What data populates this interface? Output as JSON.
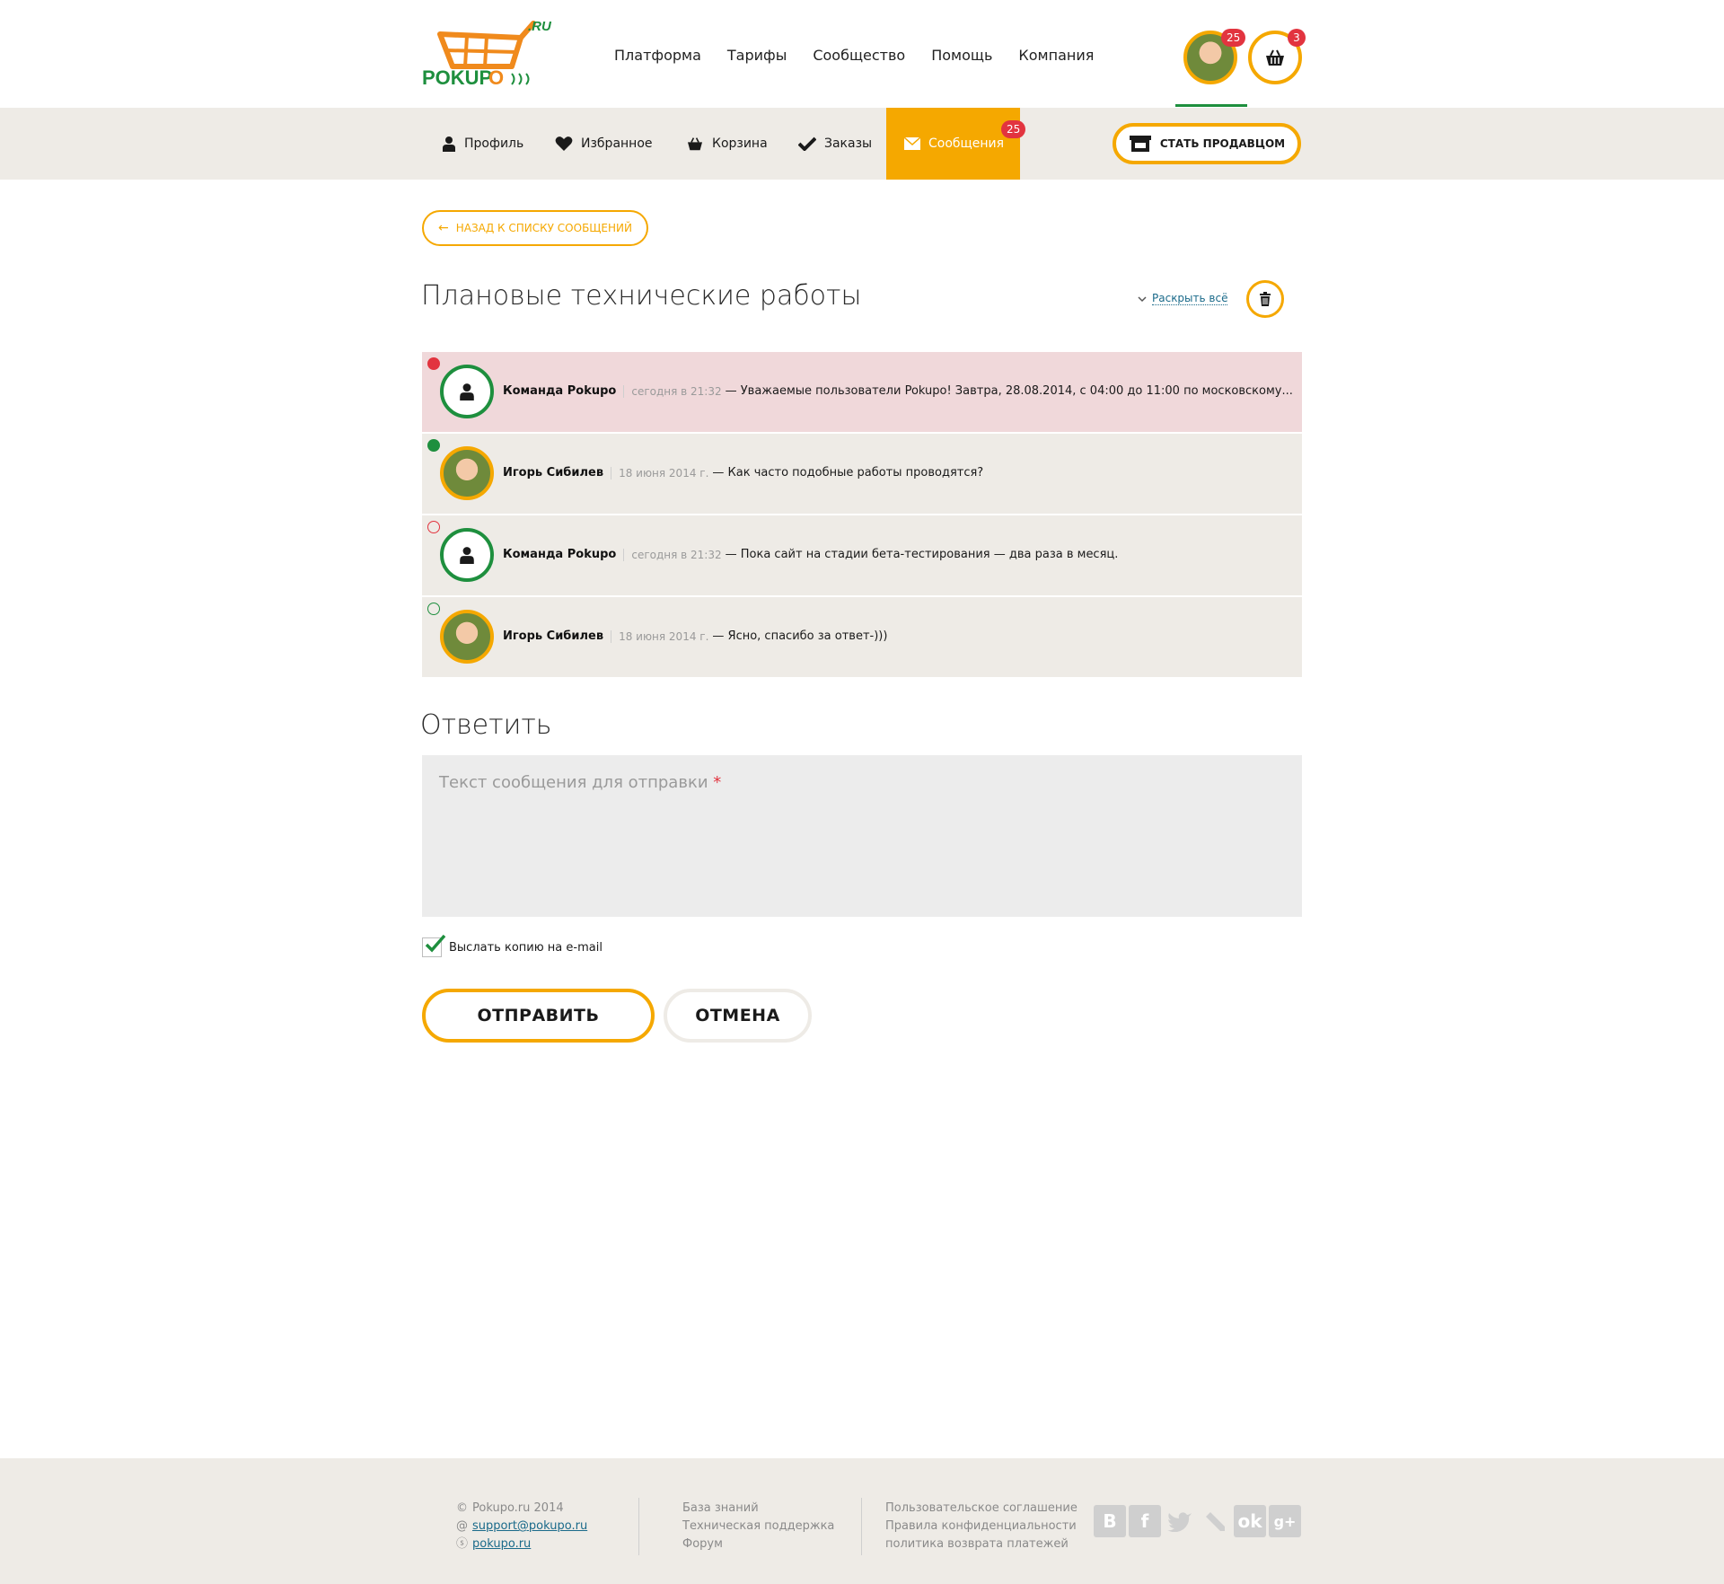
{
  "header": {
    "logo_text": "POKUPO",
    "logo_suffix": ".RU",
    "nav": [
      "Платформа",
      "Тарифы",
      "Сообщество",
      "Помощь",
      "Компания"
    ],
    "avatar_badge": "25",
    "cart_badge": "3"
  },
  "subnav": {
    "items": [
      {
        "label": "Профиль",
        "icon": "user-icon"
      },
      {
        "label": "Избранное",
        "icon": "heart-icon"
      },
      {
        "label": "Корзина",
        "icon": "basket-icon"
      },
      {
        "label": "Заказы",
        "icon": "check-icon"
      },
      {
        "label": "Сообщения",
        "icon": "envelope-icon",
        "badge": "25",
        "active": true
      }
    ],
    "seller_button": "СТАТЬ ПРОДАВЦОМ"
  },
  "page": {
    "back_label": "НАЗАД К СПИСКУ СООБЩЕНИЙ",
    "title": "Плановые технические работы",
    "expand_label": "Раскрыть всё"
  },
  "messages": [
    {
      "author": "Команда Pokupo",
      "time": "сегодня в 21:32",
      "text": "— Уважаемые пользователи Pokupo! Завтра, 28.08.2014, с 04:00 до 11:00 по московскому...",
      "avatar": "team",
      "status": "unread-red"
    },
    {
      "author": "Игорь Сибилев",
      "time": "18 июня 2014 г.",
      "text": "— Как часто подобные работы проводятся?",
      "avatar": "user",
      "status": "unread-green"
    },
    {
      "author": "Команда Pokupo",
      "time": "сегодня в 21:32",
      "text": "— Пока сайт на стадии бета-тестирования — два раза в месяц.",
      "avatar": "team",
      "status": "read-red"
    },
    {
      "author": "Игорь Сибилев",
      "time": "18 июня 2014 г.",
      "text": "— Ясно, спасибо за ответ-)))",
      "avatar": "user",
      "status": "read-green"
    }
  ],
  "reply": {
    "title": "Ответить",
    "placeholder": "Текст сообщения для отправки",
    "required_mark": "*",
    "copy_email_label": "Выслать копию на e-mail",
    "copy_email_checked": true,
    "send_label": "ОТПРАВИТЬ",
    "cancel_label": "ОТМЕНА"
  },
  "footer": {
    "copyright": "Pokupo.ru 2014",
    "email": "support@pokupo.ru",
    "skype": "pokupo.ru",
    "col2": [
      "База знаний",
      "Техническая поддержка",
      "Форум"
    ],
    "col3": [
      "Пользовательское соглашение",
      "Правила конфиденциальности",
      "политика возврата платежей"
    ],
    "socials": [
      "vk-icon",
      "facebook-icon",
      "twitter-icon",
      "livejournal-icon",
      "odnoklassniki-icon",
      "google-plus-icon"
    ]
  },
  "colors": {
    "accent": "#f5a800",
    "green": "#1e8f3e",
    "red": "#e2343f",
    "panel": "#eeebe6",
    "unread_bg": "#f0d8da"
  }
}
